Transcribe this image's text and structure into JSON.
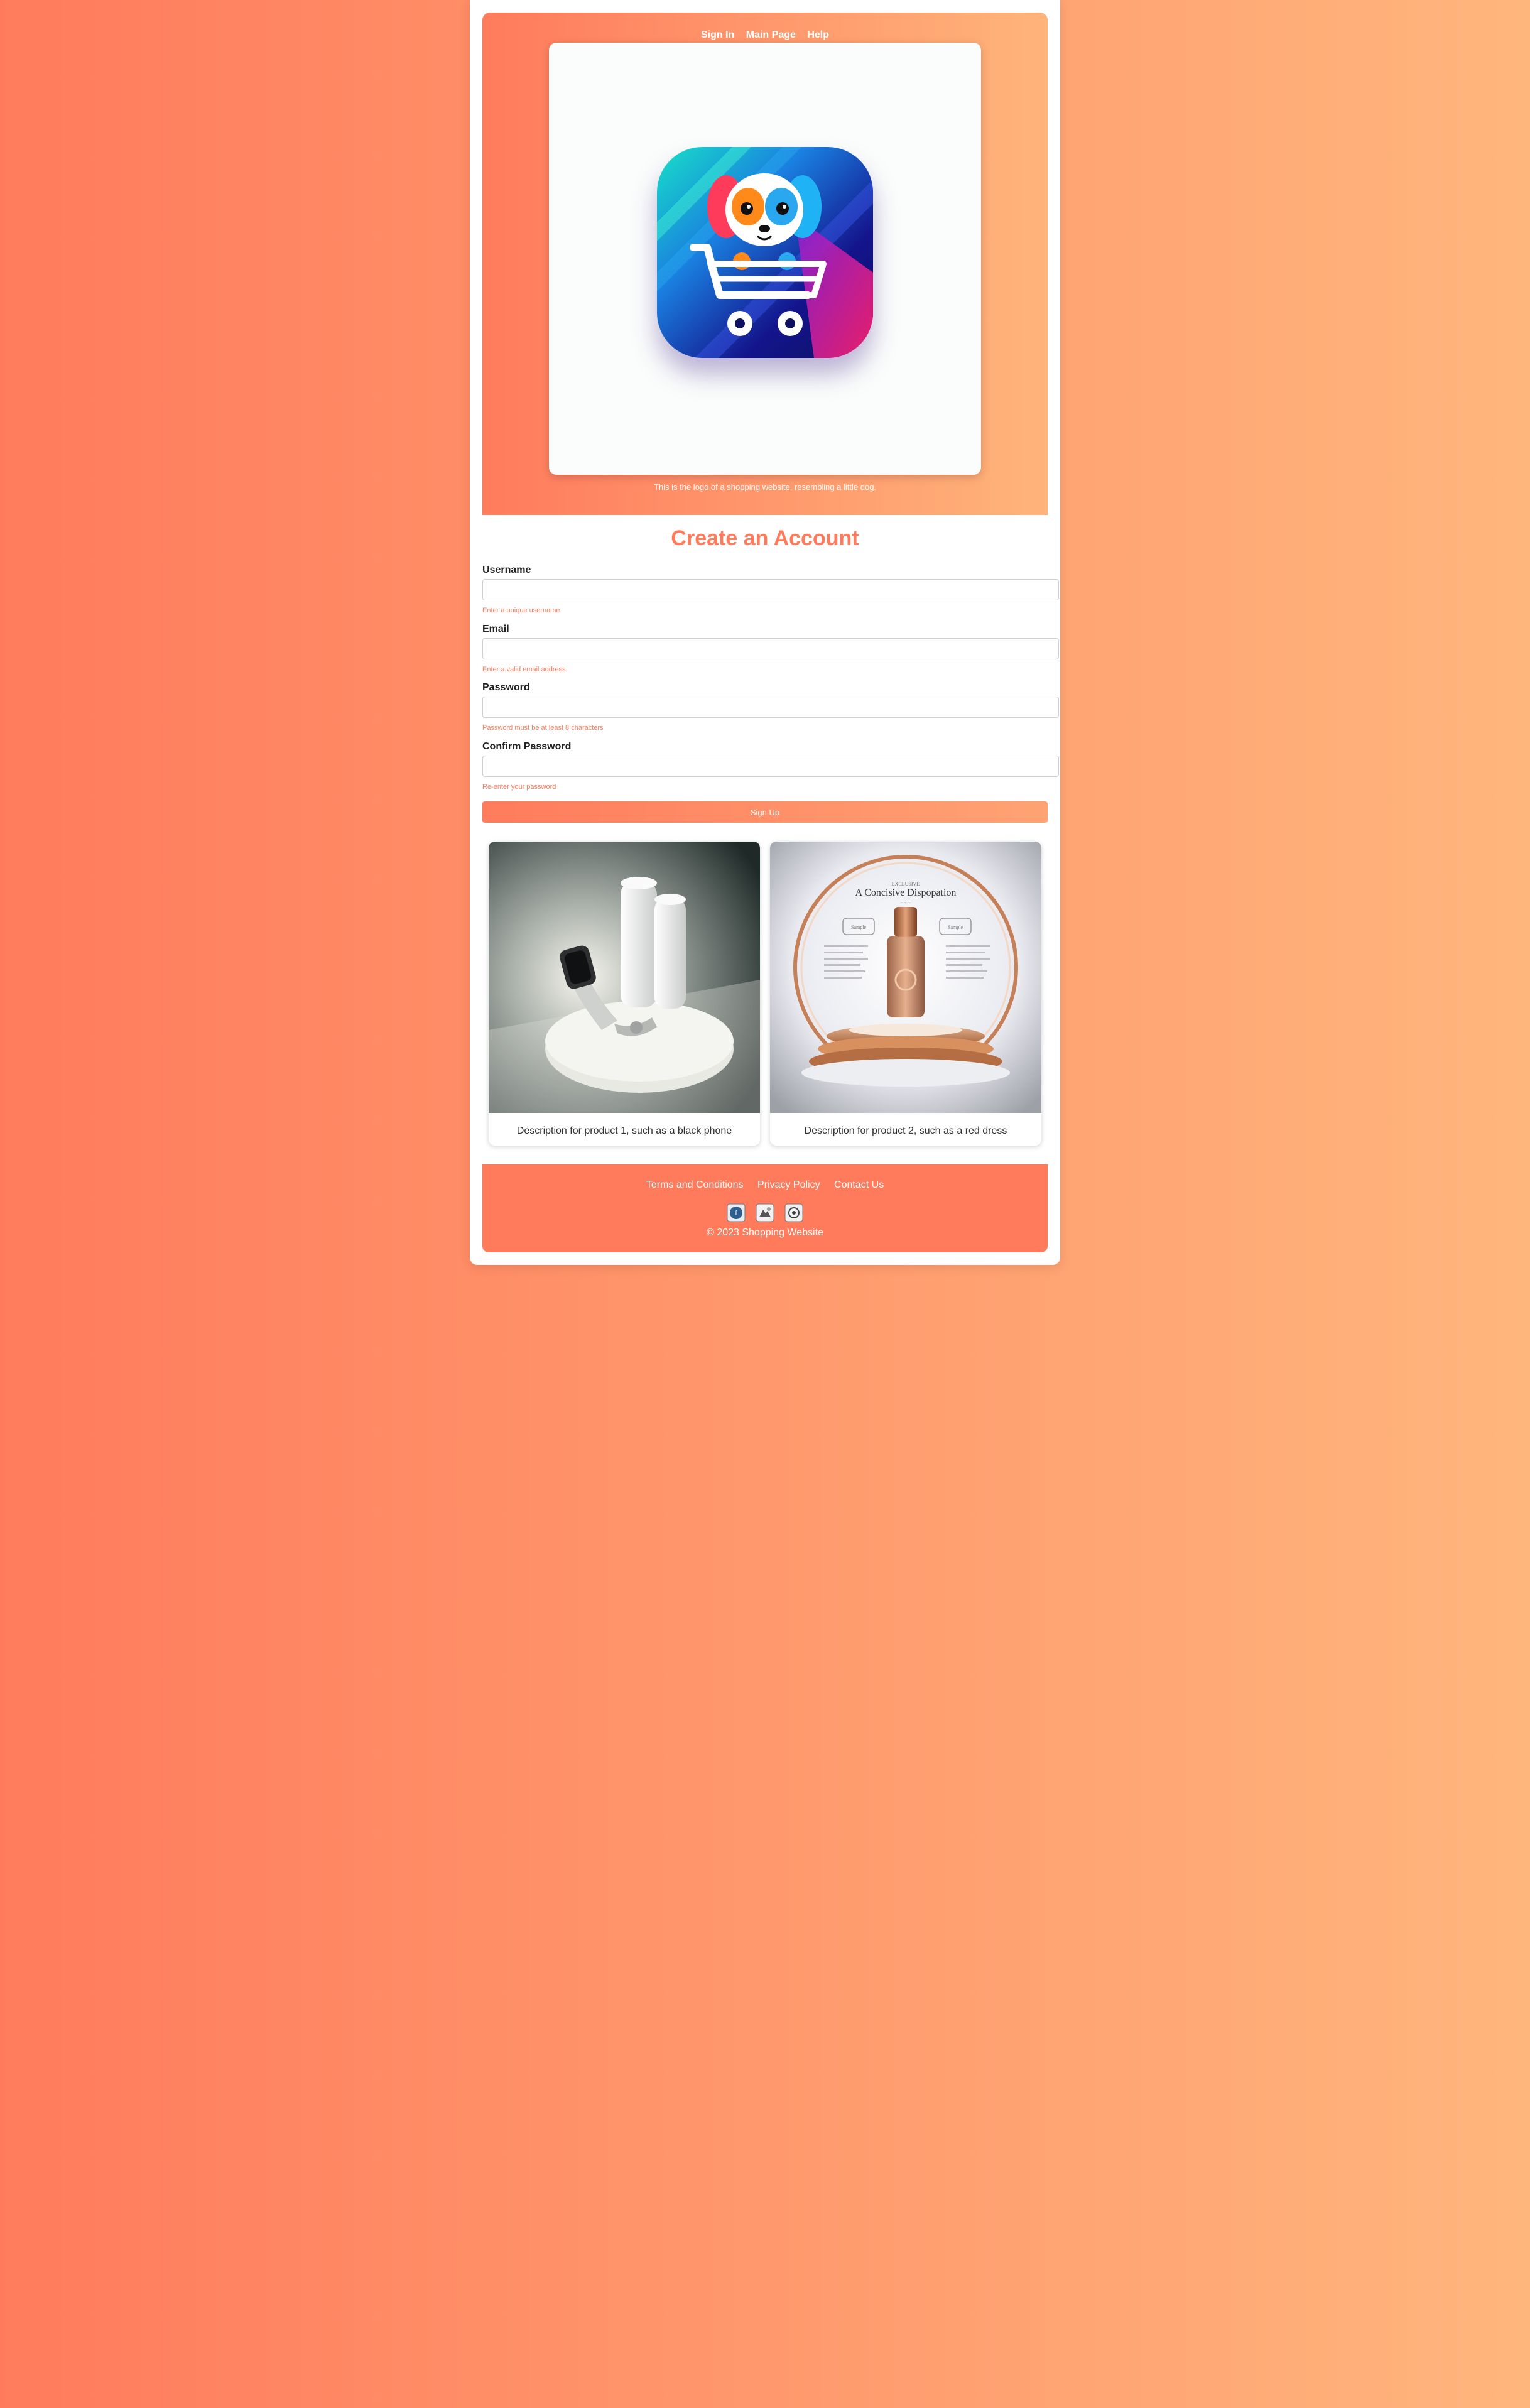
{
  "nav": {
    "links": [
      "Sign In",
      "Main Page",
      "Help"
    ]
  },
  "header": {
    "logo_caption": "This is the logo of a shopping website, resembling a little dog.",
    "logo_icon": "dog-shopping-cart-logo"
  },
  "form": {
    "title": "Create an Account",
    "fields": [
      {
        "label": "Username",
        "value": "",
        "placeholder": "",
        "hint": "Enter a unique username"
      },
      {
        "label": "Email",
        "value": "",
        "placeholder": "",
        "hint": "Enter a valid email address"
      },
      {
        "label": "Password",
        "value": "",
        "placeholder": "",
        "hint": "Password must be at least 8 characters"
      },
      {
        "label": "Confirm Password",
        "value": "",
        "placeholder": "",
        "hint": "Re-enter your password"
      }
    ],
    "submit_label": "Sign Up"
  },
  "products": [
    {
      "description": "Description for product 1, such as a black phone",
      "image": "smartwatch-product-photo"
    },
    {
      "description": "Description for product 2, such as a red dress",
      "image": "perfume-bottle-product-photo",
      "image_text": {
        "small_heading": "EXCLUSIVE",
        "heading": "A Concisive Dispopation",
        "left_badge": "Sample",
        "right_badge": "Sample",
        "divider": "~ ~ ~"
      }
    }
  ],
  "footer": {
    "links": [
      "Terms and Conditions",
      "Privacy Policy",
      "Contact Us"
    ],
    "social_icons": [
      "social-icon-1",
      "social-icon-2",
      "social-icon-3"
    ],
    "copyright": "© 2023 Shopping Website"
  },
  "colors": {
    "accent": "#ff7b5c",
    "gradient_end": "#ffb67d",
    "card": "#ffffff"
  }
}
